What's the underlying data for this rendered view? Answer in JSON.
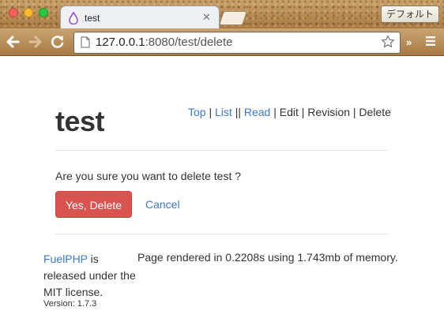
{
  "browser": {
    "tab_title": "test",
    "profile_button": "デフォルト",
    "url_host": "127.0.0.1",
    "url_rest": ":8080/test/delete",
    "extension_label": "»"
  },
  "page": {
    "title": "test",
    "nav": {
      "top": "Top",
      "list": "List",
      "read": "Read",
      "edit": "Edit",
      "revision": "Revision",
      "delete": "Delete",
      "sep": "|",
      "double_sep": "||"
    },
    "confirm_text": "Are you sure you want to delete test ?",
    "delete_button": "Yes, Delete",
    "cancel_link": "Cancel"
  },
  "footer": {
    "fuelphp_link": "FuelPHP",
    "license_text": " is released under the MIT license.",
    "version": "Version: 1.7.3",
    "render_info": "Page rendered in 0.2208s using 1.743mb of memory."
  },
  "colors": {
    "link": "#3a7ac8",
    "danger": "#d9534f",
    "text": "#333333"
  }
}
